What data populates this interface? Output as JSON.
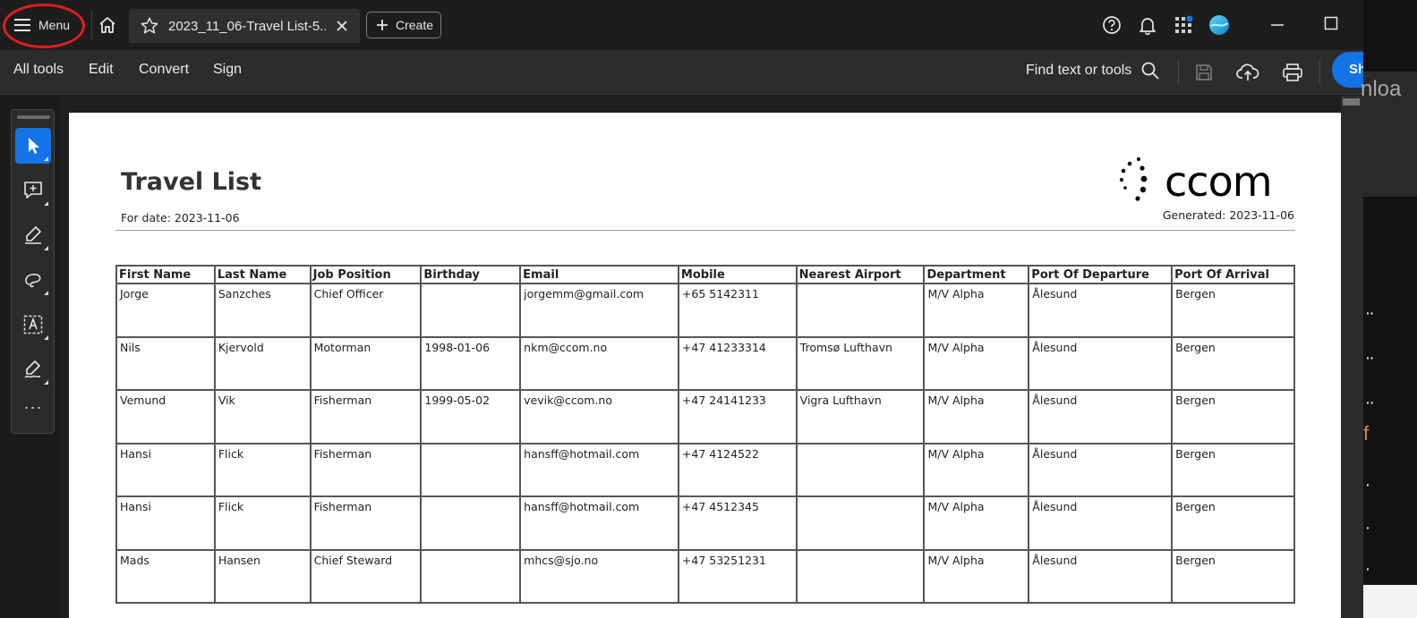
{
  "titlebar": {
    "menu_label": "Menu",
    "tab_title": "2023_11_06-Travel List-5....",
    "create_label": "Create"
  },
  "toolbar": {
    "items": [
      "All tools",
      "Edit",
      "Convert",
      "Sign"
    ],
    "find_label": "Find text or tools",
    "share_label": "Sh"
  },
  "background_window": {
    "text": "nloa"
  },
  "document": {
    "title": "Travel List",
    "for_date": "For date: 2023-11-06",
    "generated": "Generated: 2023-11-06",
    "logo_text": "ccom",
    "columns": [
      "First Name",
      "Last Name",
      "Job Position",
      "Birthday",
      "Email",
      "Mobile",
      "Nearest Airport",
      "Department",
      "Port Of Departure",
      "Port Of Arrival"
    ],
    "rows": [
      [
        "Jorge",
        "Sanzches",
        "Chief Officer",
        "",
        "jorgemm@gmail.com",
        "+65 5142311",
        "",
        "M/V Alpha",
        "Ålesund",
        "Bergen"
      ],
      [
        "Nils",
        "Kjervold",
        "Motorman",
        "1998-01-06",
        "nkm@ccom.no",
        "+47 41233314",
        "Tromsø Lufthavn",
        "M/V Alpha",
        "Ålesund",
        "Bergen"
      ],
      [
        "Vemund",
        "Vik",
        "Fisherman",
        "1999-05-02",
        "vevik@ccom.no",
        "+47 24141233",
        "Vigra Lufthavn",
        "M/V Alpha",
        "Ålesund",
        "Bergen"
      ],
      [
        "Hansi",
        "Flick",
        "Fisherman",
        "",
        "hansff@hotmail.com",
        "+47 4124522",
        "",
        "M/V Alpha",
        "Ålesund",
        "Bergen"
      ],
      [
        "Hansi",
        "Flick",
        "Fisherman",
        "",
        "hansff@hotmail.com",
        "+47 4512345",
        "",
        "M/V Alpha",
        "Ålesund",
        "Bergen"
      ],
      [
        "Mads",
        "Hansen",
        "Chief Steward",
        "",
        "mhcs@sjo.no",
        "+47 53251231",
        "",
        "M/V Alpha",
        "Ålesund",
        "Bergen"
      ]
    ]
  },
  "colors": {
    "accent": "#1473e6",
    "highlight_circle": "#e01e1e",
    "notification_dot": "#1473e6"
  },
  "icons": {
    "menu": "hamburger-icon",
    "home": "home-icon",
    "favorite": "star-icon",
    "close": "close-icon",
    "create": "plus-icon",
    "help": "help-icon",
    "notifications": "bell-icon",
    "apps": "apps-grid-icon",
    "profile": "profile-icon",
    "search": "search-icon",
    "save": "save-icon",
    "upload": "cloud-upload-icon",
    "print": "print-icon"
  }
}
